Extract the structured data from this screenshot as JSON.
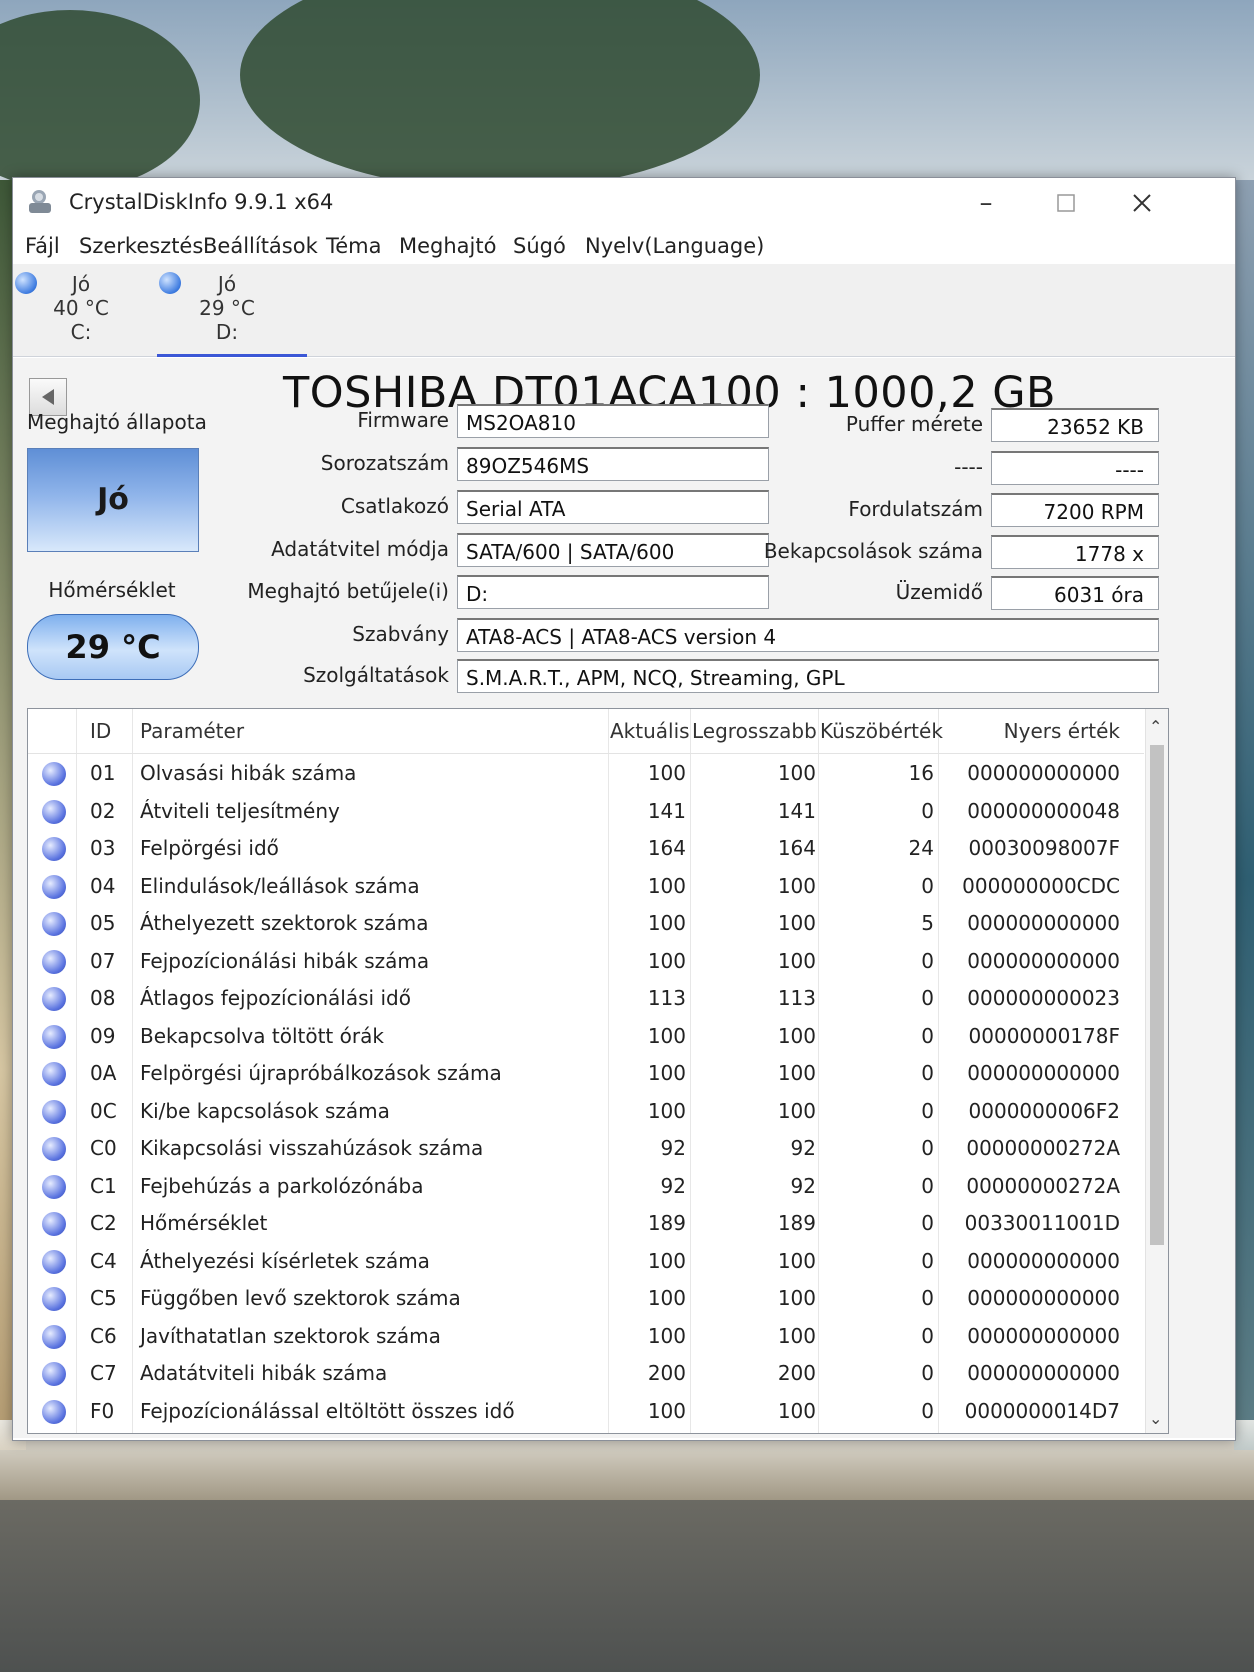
{
  "window": {
    "title": "CrystalDiskInfo 9.9.1 x64"
  },
  "menu": [
    "Fájl",
    "Szerkesztés",
    "Beállítások",
    "Téma",
    "Meghajtó",
    "Súgó",
    "Nyelv(Language)"
  ],
  "drives": [
    {
      "status": "Jó",
      "temp": "40 °C",
      "letter": "C:"
    },
    {
      "status": "Jó",
      "temp": "29 °C",
      "letter": "D:"
    }
  ],
  "disk": {
    "title": "TOSHIBA DT01ACA100 : 1000,2 GB",
    "status_label": "Meghajtó állapota",
    "status_value": "Jó",
    "temp_label": "Hőmérséklet",
    "temp_value": "29 °C",
    "left_fields": [
      {
        "label": "Firmware",
        "value": "MS2OA810"
      },
      {
        "label": "Sorozatszám",
        "value": "89OZ546MS"
      },
      {
        "label": "Csatlakozó",
        "value": "Serial ATA"
      },
      {
        "label": "Adatátvitel módja",
        "value": "SATA/600 | SATA/600"
      },
      {
        "label": "Meghajtó betűjele(i)",
        "value": "D:"
      }
    ],
    "right_fields": [
      {
        "label": "Puffer mérete",
        "value": "23652 KB"
      },
      {
        "label": "----",
        "value": "----"
      },
      {
        "label": "Fordulatszám",
        "value": "7200 RPM"
      },
      {
        "label": "Bekapcsolások száma",
        "value": "1778 x"
      },
      {
        "label": "Üzemidő",
        "value": "6031 óra"
      }
    ],
    "wide_fields": [
      {
        "label": "Szabvány",
        "value": "ATA8-ACS | ATA8-ACS version 4"
      },
      {
        "label": "Szolgáltatások",
        "value": "S.M.A.R.T., APM, NCQ, Streaming, GPL"
      }
    ]
  },
  "smart": {
    "headers": [
      "ID",
      "Paraméter",
      "Aktuális",
      "Legrosszabb",
      "Küszöbérték",
      "Nyers érték"
    ],
    "rows": [
      [
        "01",
        "Olvasási hibák száma",
        "100",
        "100",
        "16",
        "000000000000"
      ],
      [
        "02",
        "Átviteli teljesítmény",
        "141",
        "141",
        "0",
        "000000000048"
      ],
      [
        "03",
        "Felpörgési idő",
        "164",
        "164",
        "24",
        "00030098007F"
      ],
      [
        "04",
        "Elindulások/leállások száma",
        "100",
        "100",
        "0",
        "000000000CDC"
      ],
      [
        "05",
        "Áthelyezett szektorok száma",
        "100",
        "100",
        "5",
        "000000000000"
      ],
      [
        "07",
        "Fejpozícionálási hibák száma",
        "100",
        "100",
        "0",
        "000000000000"
      ],
      [
        "08",
        "Átlagos fejpozícionálási idő",
        "113",
        "113",
        "0",
        "000000000023"
      ],
      [
        "09",
        "Bekapcsolva töltött órák",
        "100",
        "100",
        "0",
        "00000000178F"
      ],
      [
        "0A",
        "Felpörgési újrapróbálkozások száma",
        "100",
        "100",
        "0",
        "000000000000"
      ],
      [
        "0C",
        "Ki/be kapcsolások száma",
        "100",
        "100",
        "0",
        "0000000006F2"
      ],
      [
        "C0",
        "Kikapcsolási visszahúzások száma",
        "92",
        "92",
        "0",
        "00000000272A"
      ],
      [
        "C1",
        "Fejbehúzás a parkolózónába",
        "92",
        "92",
        "0",
        "00000000272A"
      ],
      [
        "C2",
        "Hőmérséklet",
        "189",
        "189",
        "0",
        "00330011001D"
      ],
      [
        "C4",
        "Áthelyezési kísérletek száma",
        "100",
        "100",
        "0",
        "000000000000"
      ],
      [
        "C5",
        "Függőben levő szektorok száma",
        "100",
        "100",
        "0",
        "000000000000"
      ],
      [
        "C6",
        "Javíthatatlan szektorok száma",
        "100",
        "100",
        "0",
        "000000000000"
      ],
      [
        "C7",
        "Adatátviteli hibák száma",
        "200",
        "200",
        "0",
        "000000000000"
      ],
      [
        "F0",
        "Fejpozícionálással eltöltött összes idő",
        "100",
        "100",
        "0",
        "0000000014D7"
      ]
    ]
  },
  "colors": {
    "accent": "#3b57d6",
    "good": "#5f8fd6"
  }
}
